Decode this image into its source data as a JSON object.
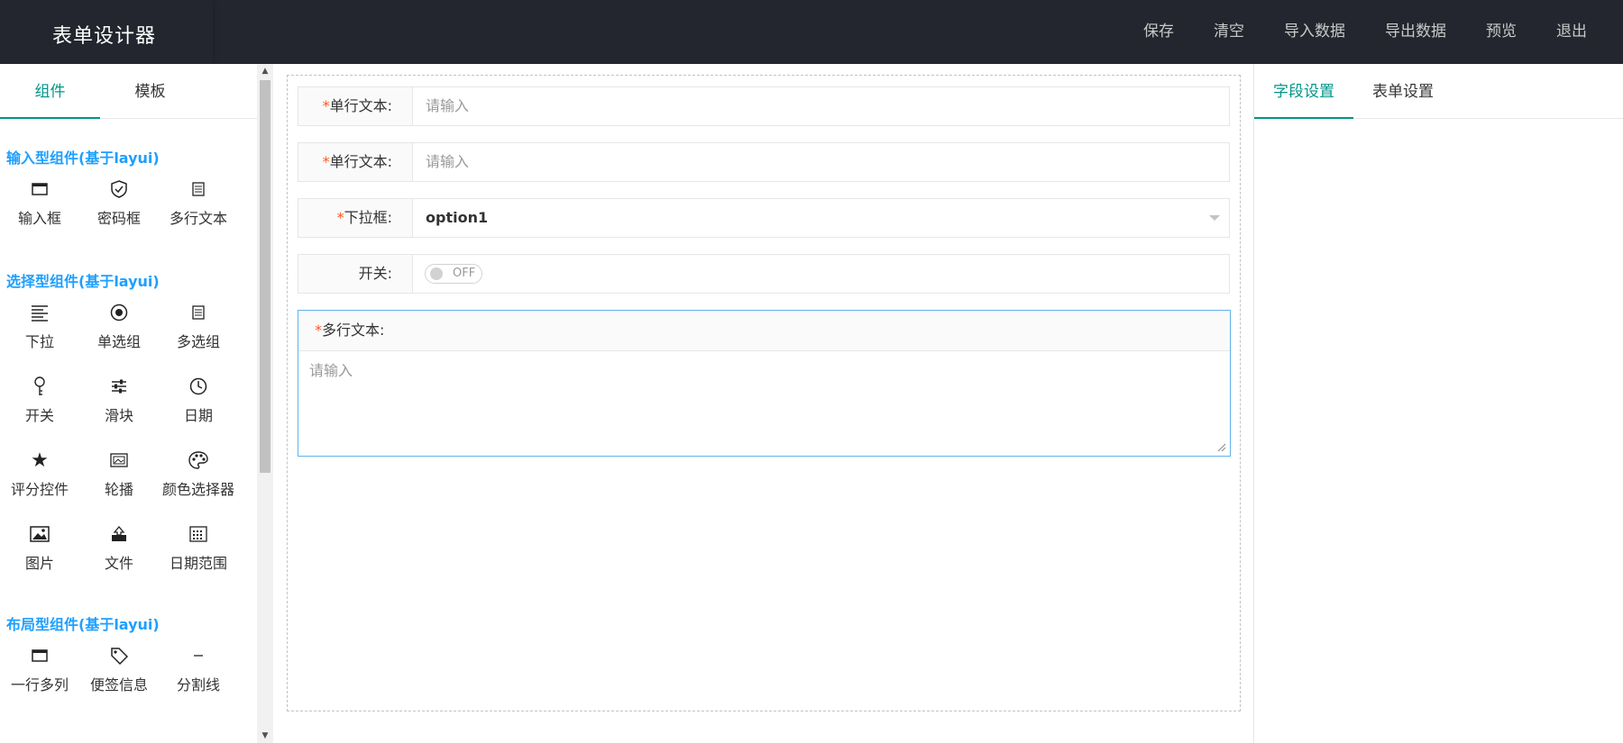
{
  "header": {
    "title": "表单设计器",
    "nav": [
      "保存",
      "清空",
      "导入数据",
      "导出数据",
      "预览",
      "退出"
    ]
  },
  "left": {
    "tabs": [
      "组件",
      "模板"
    ],
    "sections": [
      {
        "title": "输入型组件(基于layui)",
        "items": [
          {
            "label": "输入框",
            "icon": "input-icon"
          },
          {
            "label": "密码框",
            "icon": "shield-icon"
          },
          {
            "label": "多行文本",
            "icon": "textarea-icon"
          }
        ]
      },
      {
        "title": "选择型组件(基于layui)",
        "items": [
          {
            "label": "下拉",
            "icon": "list-icon"
          },
          {
            "label": "单选组",
            "icon": "radio-icon"
          },
          {
            "label": "多选组",
            "icon": "checkbox-icon"
          },
          {
            "label": "开关",
            "icon": "switch-icon"
          },
          {
            "label": "滑块",
            "icon": "slider-icon"
          },
          {
            "label": "日期",
            "icon": "clock-icon"
          },
          {
            "label": "评分控件",
            "icon": "star-icon"
          },
          {
            "label": "轮播",
            "icon": "carousel-icon"
          },
          {
            "label": "颜色选择器",
            "icon": "palette-icon"
          },
          {
            "label": "图片",
            "icon": "image-icon"
          },
          {
            "label": "文件",
            "icon": "upload-icon"
          },
          {
            "label": "日期范围",
            "icon": "calendar-icon"
          }
        ]
      },
      {
        "title": "布局型组件(基于layui)",
        "items": [
          {
            "label": "一行多列",
            "icon": "columns-icon"
          },
          {
            "label": "便签信息",
            "icon": "tag-icon"
          },
          {
            "label": "分割线",
            "icon": "divider-icon"
          }
        ]
      }
    ]
  },
  "form": {
    "fields": [
      {
        "label": "单行文本:",
        "required": "*",
        "placeholder": "请输入"
      },
      {
        "label": "单行文本:",
        "required": "*",
        "placeholder": "请输入"
      },
      {
        "label": "下拉框:",
        "required": "*",
        "value": "option1"
      },
      {
        "label": "开关:",
        "required": "",
        "value": "OFF"
      }
    ],
    "textarea": {
      "label": "多行文本:",
      "required": "*",
      "placeholder": "请输入"
    }
  },
  "right": {
    "tabs": [
      "字段设置",
      "表单设置"
    ]
  },
  "colors": {
    "accent": "#009688",
    "section": "#1e9fff",
    "header": "#23262e",
    "required": "#ff5722"
  }
}
